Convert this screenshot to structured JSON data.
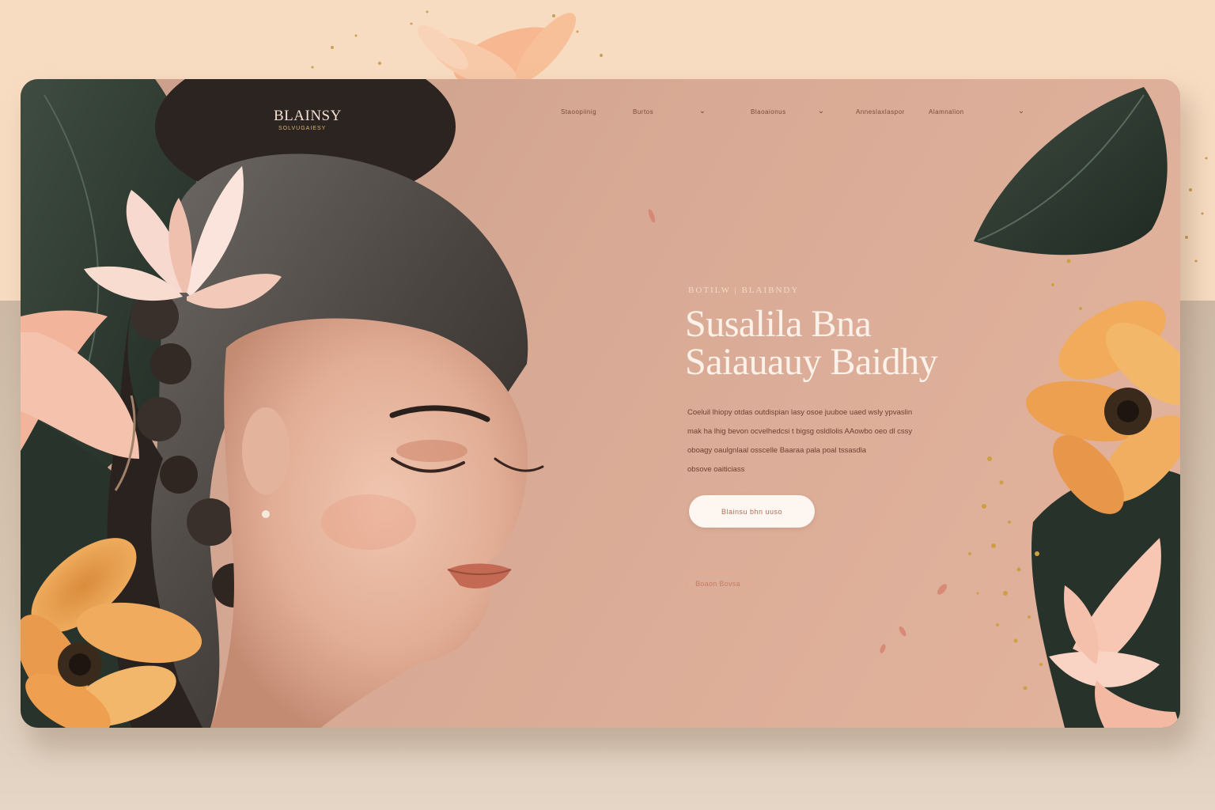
{
  "brand": {
    "logo": "BLAINSY",
    "tagline": "SOLVUGAIESY"
  },
  "nav": {
    "items": [
      {
        "label": "Staoopiinig"
      },
      {
        "label": "Burtos"
      },
      {
        "label": "Blaoaionus"
      },
      {
        "label": "Anneslaxlaspor"
      },
      {
        "label": "Alamnalion"
      }
    ]
  },
  "hero": {
    "eyebrow": "BOTILW | BLAIBNDY",
    "headline_line1": "Susalila Bna",
    "headline_line2": "Saiauauy Baidhy",
    "body_lines": [
      "Coeluil lhiopy otdas outdispian lasy osoe juuboe uaed wsly ypvaslin",
      "mak ha lhig bevon ocvelhedcsi t bigsg osldlolis AAowbo oeo dl cssy",
      "oboagy oaulgnlaal osscelle Baaraa pala poal tssasdla",
      "obsove oaiticiass"
    ],
    "cta_primary": "Blainsu  bhn uuso",
    "cta_secondary": "Boaon Bovsa"
  },
  "colors": {
    "page_background": "#f8dcc2",
    "window_background": "#d8aa95",
    "headline": "#fdf2ea",
    "accent_gold": "#d9b56e",
    "leaf_dark": "#2e3a30",
    "flower_orange": "#eea55a",
    "flower_pink": "#f4c2ad"
  },
  "icons": {
    "nav_chevrons": [
      "chevron-down-icon",
      "chevron-down-icon",
      "chevron-down-icon"
    ]
  }
}
